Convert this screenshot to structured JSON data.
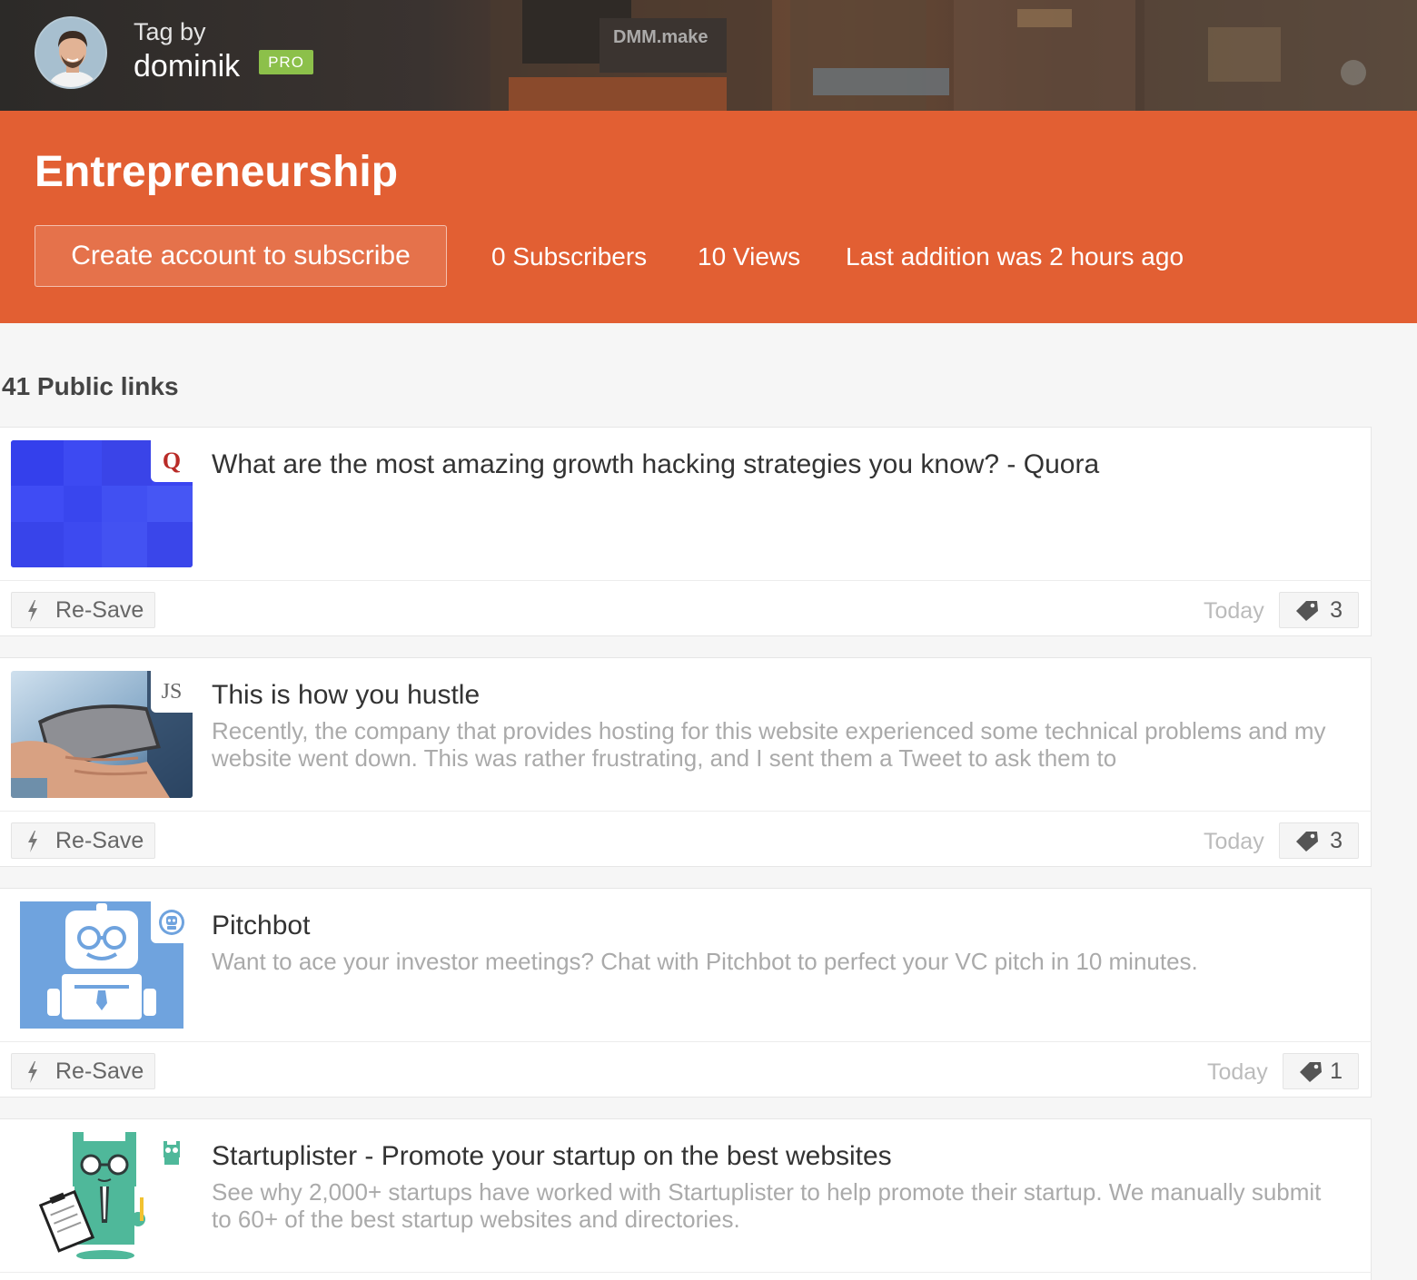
{
  "header": {
    "tag_by_label": "Tag by",
    "owner_name": "dominik",
    "owner_badge": "PRO",
    "banner_sign_text": "DMM.make"
  },
  "hero": {
    "tag_name": "Entrepreneurship",
    "subscribe_button": "Create account to subscribe",
    "subscribers": "0 Subscribers",
    "views": "10 Views",
    "last_addition": "Last addition was 2 hours ago"
  },
  "list": {
    "title": "41 Public links",
    "resave_label": "Re-Save",
    "items": [
      {
        "title": "What are the most amazing growth hacking strategies you know? - Quora",
        "description": "",
        "favicon_text": "Q",
        "favicon_icon": "quora-icon",
        "date": "Today",
        "tag_count": "3"
      },
      {
        "title": "This is how you hustle",
        "description": "Recently, the company that provides hosting for this website experienced some technical problems and my website went down. This was rather frustrating, and I sent them a Tweet to ask them to",
        "favicon_text": "JS",
        "favicon_icon": "js-site-icon",
        "date": "Today",
        "tag_count": "3"
      },
      {
        "title": "Pitchbot",
        "description": "Want to ace your investor meetings? Chat with Pitchbot to perfect your VC pitch in 10 minutes.",
        "favicon_text": "",
        "favicon_icon": "robot-icon",
        "date": "Today",
        "tag_count": "1"
      },
      {
        "title": "Startuplister - Promote your startup on the best websites",
        "description": "See why 2,000+ startups have worked with Startuplister to help promote their startup. We manually submit to 60+ of the best startup websites and directories.",
        "favicon_text": "",
        "favicon_icon": "startuplister-cat-icon",
        "date": "",
        "tag_count": ""
      }
    ]
  },
  "colors": {
    "hero_orange": "#e25f33",
    "pro_green": "#8cc04a",
    "quora_red": "#b92b27",
    "pitchbot_blue": "#6fa3de",
    "startuplister_teal": "#4fb89a"
  }
}
